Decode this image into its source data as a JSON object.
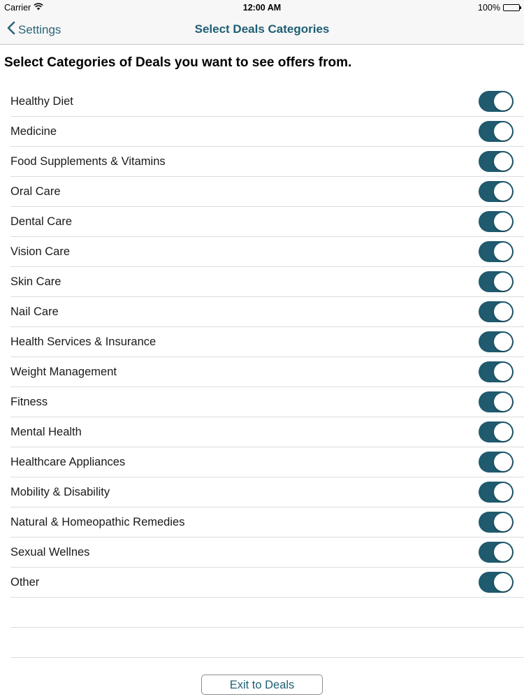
{
  "status_bar": {
    "carrier": "Carrier",
    "time": "12:00 AM",
    "battery": "100%",
    "wifi_icon": "wifi-icon",
    "battery_icon": "battery-icon"
  },
  "nav_bar": {
    "back_label": "Settings",
    "back_icon": "chevron-left-icon",
    "title": "Select Deals Categories"
  },
  "heading": "Select Categories of Deals you want to see offers from.",
  "categories": [
    {
      "label": "Healthy Diet",
      "enabled": true
    },
    {
      "label": "Medicine",
      "enabled": true
    },
    {
      "label": "Food Supplements & Vitamins",
      "enabled": true
    },
    {
      "label": "Oral Care",
      "enabled": true
    },
    {
      "label": "Dental Care",
      "enabled": true
    },
    {
      "label": "Vision Care",
      "enabled": true
    },
    {
      "label": "Skin Care",
      "enabled": true
    },
    {
      "label": "Nail Care",
      "enabled": true
    },
    {
      "label": "Health Services & Insurance",
      "enabled": true
    },
    {
      "label": "Weight Management",
      "enabled": true
    },
    {
      "label": "Fitness",
      "enabled": true
    },
    {
      "label": "Mental Health",
      "enabled": true
    },
    {
      "label": "Healthcare Appliances",
      "enabled": true
    },
    {
      "label": "Mobility & Disability",
      "enabled": true
    },
    {
      "label": "Natural & Homeopathic Remedies",
      "enabled": true
    },
    {
      "label": "Sexual Wellnes",
      "enabled": true
    },
    {
      "label": "Other",
      "enabled": true
    }
  ],
  "footer": {
    "exit_label": "Exit to Deals"
  },
  "colors": {
    "accent": "#1f5f73",
    "toggle_on": "#1f5a6e"
  }
}
